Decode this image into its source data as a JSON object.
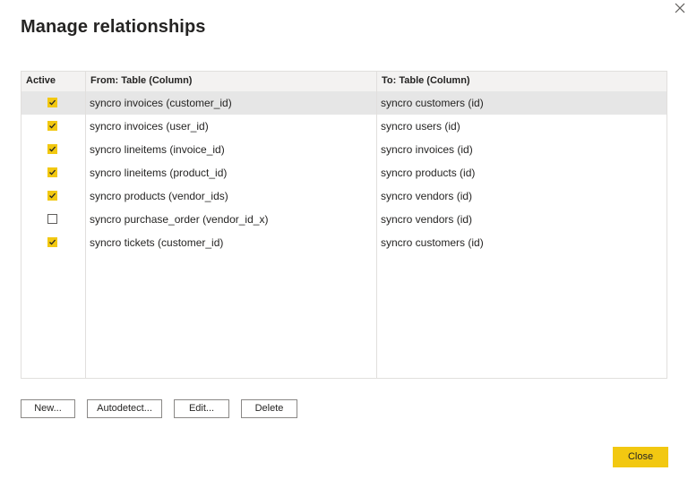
{
  "dialog": {
    "title": "Manage relationships",
    "close_icon": "close-icon"
  },
  "table": {
    "headers": {
      "active": "Active",
      "from": "From: Table (Column)",
      "to": "To: Table (Column)"
    },
    "rows": [
      {
        "active": true,
        "from": "syncro invoices (customer_id)",
        "to": "syncro customers (id)",
        "selected": true
      },
      {
        "active": true,
        "from": "syncro invoices (user_id)",
        "to": "syncro users (id)"
      },
      {
        "active": true,
        "from": "syncro lineitems (invoice_id)",
        "to": "syncro invoices (id)"
      },
      {
        "active": true,
        "from": "syncro lineitems (product_id)",
        "to": "syncro products (id)"
      },
      {
        "active": true,
        "from": "syncro products (vendor_ids)",
        "to": "syncro vendors (id)"
      },
      {
        "active": false,
        "from": "syncro purchase_order (vendor_id_x)",
        "to": "syncro vendors (id)"
      },
      {
        "active": true,
        "from": "syncro tickets (customer_id)",
        "to": "syncro customers (id)"
      }
    ]
  },
  "buttons": {
    "new": "New...",
    "autodetect": "Autodetect...",
    "edit": "Edit...",
    "delete": "Delete",
    "close": "Close"
  },
  "colors": {
    "accent": "#f2c811",
    "selected_row": "#e6e6e6",
    "header_bg": "#f3f2f1"
  }
}
